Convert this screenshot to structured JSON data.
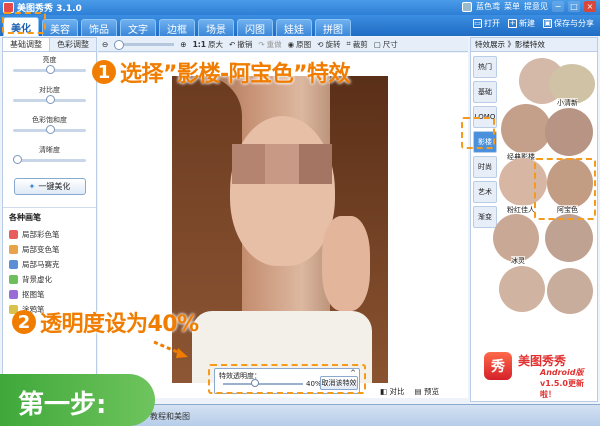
{
  "window": {
    "title": "美图秀秀 3.1.0",
    "user": "蓝色鸢",
    "menu": "菜单",
    "suggest": "提意见"
  },
  "tabs": [
    "美化",
    "美容",
    "饰品",
    "文字",
    "边框",
    "场景",
    "闪图",
    "娃娃",
    "拼图"
  ],
  "tab_actions": {
    "open": "打开",
    "new": "新建",
    "save": "保存与分享"
  },
  "left_panel": {
    "subtabs": [
      "基础调整",
      "色彩调整"
    ],
    "adjustments": [
      "亮度",
      "对比度",
      "色彩饱和度",
      "清晰度"
    ],
    "one_key": "一键美化",
    "section_title": "各种画笔",
    "tools": [
      "局部彩色笔",
      "局部变色笔",
      "局部马赛克",
      "背景虚化",
      "抠图笔",
      "涂鸦笔"
    ]
  },
  "toolbar": {
    "ratio": "1:1",
    "original": "原大",
    "undo": "撤销",
    "redo": "重做",
    "original_img": "原图",
    "rotate": "旋转",
    "crop": "裁剪",
    "size": "尺寸"
  },
  "right_panel": {
    "header": "特效展示 》影楼特效",
    "categories": [
      "热门",
      "基础",
      "LOMO",
      "影楼",
      "时尚",
      "艺术",
      "渐变"
    ],
    "thumb_labels": [
      "小清新",
      "经典影楼",
      "粉红佳人",
      "阿宝色",
      "冰灵"
    ]
  },
  "transparency": {
    "label": "特效透明度：",
    "value": "40%",
    "cancel": "取消该特效"
  },
  "bottom": {
    "compare": "对比",
    "preview": "预览",
    "status": "教程和美图"
  },
  "callouts": {
    "step1_num": "1",
    "step1_text": "选择”影楼-阿宝色”特效",
    "step2_num": "2",
    "step2_text": "透明度设为40%",
    "step_label": "第一步:"
  },
  "promo": {
    "logo": "秀",
    "name": "美图秀秀",
    "sub": "Android版",
    "ver": "v1.5.0更新啦！"
  },
  "colors": {
    "accent": "#f07d00",
    "tab_bar": "#2d7fd6",
    "step_green": "#3fa83a",
    "promo_red": "#e23030"
  },
  "transparency_level": 0.4
}
